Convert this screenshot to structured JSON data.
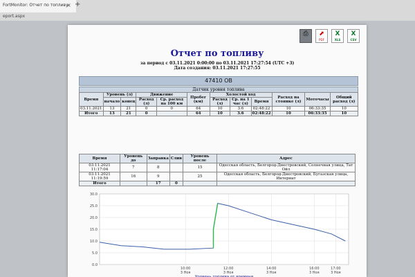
{
  "browser": {
    "tab_title": "FortMonitor: Отчет по топливу",
    "close_glyph": "×",
    "new_tab_glyph": "+",
    "address_fragment": "eport.aspx"
  },
  "export": {
    "print_label": "",
    "pdf_label": "PDF",
    "xls_label": "XLS",
    "csv_label": "CSV"
  },
  "report": {
    "title": "Отчет по топливу",
    "period": "за период с 03.11.2021 0:00:00 по 03.11.2021 17:27:54 (UTC +3)",
    "created": "Дата создания: 03.11.2021 17:27:55",
    "vehicle": "47410 ОВ",
    "sensor_header": "Датчик уровня топлива"
  },
  "table1": {
    "h_time": "Время",
    "h_level": "Уровень (л)",
    "h_level_start": "начало",
    "h_level_end": "конец",
    "h_movement": "Движение",
    "h_mv_consumption": "Расход (л)",
    "h_mv_avg": "Ср. расход на 100 км",
    "h_mileage": "Пробег (км)",
    "h_idle": "Холостой ход",
    "h_idle_consumption": "Расход (л)",
    "h_idle_avg": "Ср. на 1 час (л)",
    "h_idle_time": "Время",
    "h_parking": "Расход на стоянке (л)",
    "h_engine_hours": "Моточасы",
    "h_total": "Общий расход (л)",
    "rows": [
      {
        "time": "03.11.2021",
        "start": "13",
        "end": "21",
        "mv_cons": "0",
        "mv_avg": "0",
        "mileage": "64",
        "idle_cons": "10",
        "idle_avg": "3.6",
        "idle_time": "02:48:22",
        "parking": "10",
        "engine": "06:33:35",
        "total": "10"
      },
      {
        "time": "Итого",
        "start": "13",
        "end": "21",
        "mv_cons": "0",
        "mv_avg": "",
        "mileage": "64",
        "idle_cons": "10",
        "idle_avg": "3.6",
        "idle_time": "02:48:22",
        "parking": "10",
        "engine": "06:33:35",
        "total": "10"
      }
    ]
  },
  "table2": {
    "h_time": "Время",
    "h_level_before": "Уровень до",
    "h_refuel": "Заправка",
    "h_drain": "Слив",
    "h_level_after": "Уровень после",
    "h_address": "Адрес",
    "rows": [
      {
        "time": "03.11.2021 11:17:04",
        "before": "7",
        "refuel": "8",
        "drain": "",
        "after": "15",
        "address": "Одесская область, Белгород-Днестровский, Солнечная улица, Тат Ойл"
      },
      {
        "time": "03.11.2021 11:19:59",
        "before": "16",
        "refuel": "9",
        "drain": "",
        "after": "25",
        "address": "Одесская область, Белгород-Днестровский, Бугазская улица, Интернат"
      }
    ],
    "total_label": "Итого",
    "total_refuel": "17",
    "total_drain": "0"
  },
  "chart_data": {
    "type": "line",
    "title": "",
    "xlabel": "Уровень топлива от времени",
    "ylabel": "",
    "ylim": [
      0,
      30
    ],
    "yticks": [
      "0.0",
      "5.0",
      "10.0",
      "15.0",
      "20.0",
      "25.0",
      "30.0"
    ],
    "xticks": [
      "10:00\n3 Ноя",
      "12:00\n3 Ноя",
      "14:00\n3 Ноя",
      "16:00\n3 Ноя",
      "17:00\n3 Ноя"
    ],
    "xticks_time": [
      10,
      12,
      14,
      16,
      17
    ],
    "series": [
      {
        "values": [
          [
            6.0,
            9.5
          ],
          [
            7.0,
            8.0
          ],
          [
            8.0,
            7.5
          ],
          [
            9.0,
            6.5
          ],
          [
            10.2,
            6.5
          ],
          [
            11.3,
            7.0
          ],
          [
            11.3,
            15.0
          ],
          [
            11.5,
            26.0
          ],
          [
            12.0,
            25.0
          ],
          [
            13.0,
            22.0
          ],
          [
            14.0,
            19.0
          ],
          [
            15.0,
            17.0
          ],
          [
            16.0,
            15.0
          ],
          [
            16.8,
            13.0
          ],
          [
            17.45,
            10.0
          ]
        ]
      }
    ],
    "grid": true,
    "color_main": "#3a5fa8",
    "color_refuel": "#2fb84a"
  }
}
